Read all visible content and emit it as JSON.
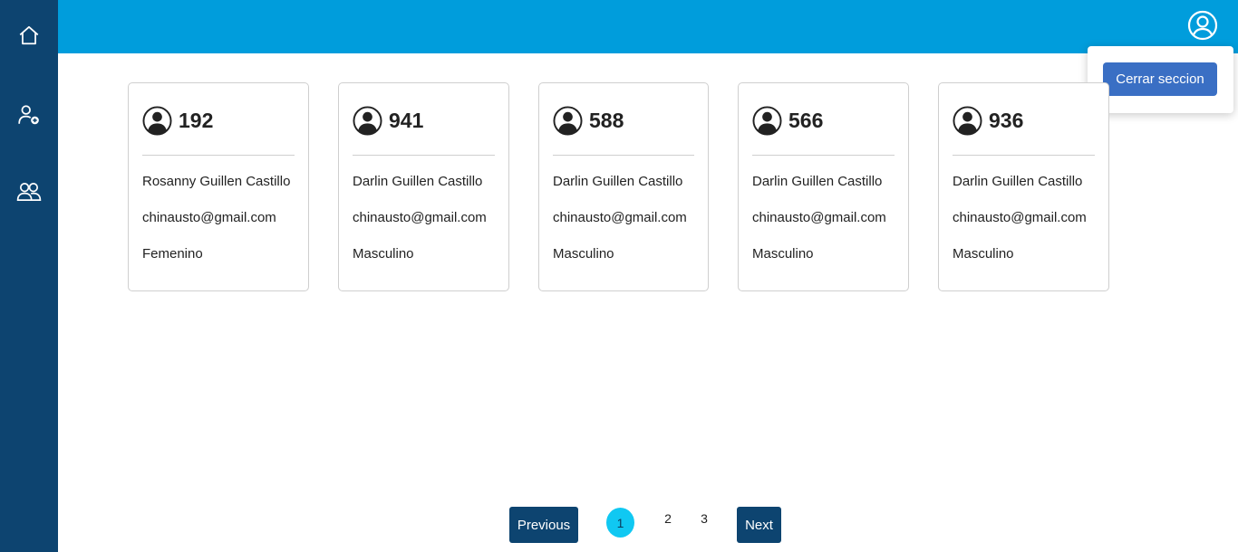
{
  "sidebar": {
    "items": [
      {
        "icon": "home-icon"
      },
      {
        "icon": "add-user-icon"
      },
      {
        "icon": "users-group-icon"
      }
    ]
  },
  "header": {
    "profile_icon": "user-circle-icon"
  },
  "profile_menu": {
    "logout_label": "Cerrar seccion"
  },
  "cards": [
    {
      "id": "192",
      "name": "Rosanny Guillen Castillo",
      "email": "chinausto@gmail.com",
      "gender": "Femenino"
    },
    {
      "id": "941",
      "name": "Darlin Guillen Castillo",
      "email": "chinausto@gmail.com",
      "gender": "Masculino"
    },
    {
      "id": "588",
      "name": "Darlin Guillen Castillo",
      "email": "chinausto@gmail.com",
      "gender": "Masculino"
    },
    {
      "id": "566",
      "name": "Darlin Guillen Castillo",
      "email": "chinausto@gmail.com",
      "gender": "Masculino"
    },
    {
      "id": "936",
      "name": "Darlin Guillen Castillo",
      "email": "chinausto@gmail.com",
      "gender": "Masculino"
    }
  ],
  "pagination": {
    "previous_label": "Previous",
    "next_label": "Next",
    "pages": [
      "1",
      "2",
      "3"
    ],
    "current_page": "1"
  },
  "colors": {
    "sidebar": "#0d4470",
    "topbar": "#009ddc",
    "logout_button": "#3a6fc4",
    "active_page": "#10c8f2"
  }
}
